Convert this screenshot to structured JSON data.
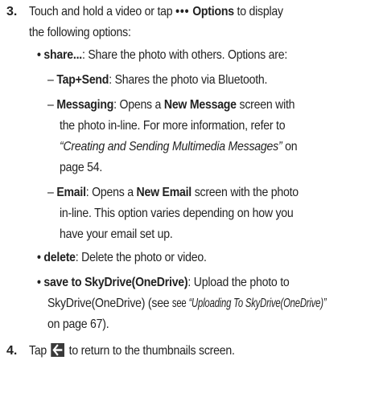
{
  "step3": {
    "number": "3.",
    "line1": "Touch and hold a video or tap",
    "options_icon": "•••",
    "options_label": "Options",
    "line1_end": "to display",
    "line2": "the following options:",
    "share": {
      "label": "share...",
      "text": ": Share the photo with others. Options are:"
    },
    "tapsend": {
      "dash": "–",
      "label": "Tap+Send",
      "text": ": Shares the photo via Bluetooth."
    },
    "messaging": {
      "dash": "–",
      "label": "Messaging",
      "text_a": ": Opens a",
      "screen_label": "New Message",
      "text_b": "screen with",
      "line2": "the photo in-line. For more information, refer to",
      "ref": "“Creating and Sending Multimedia Messages”",
      "ref_after": "on",
      "line4": "page 54."
    },
    "email": {
      "dash": "–",
      "label": "Email",
      "text_a": ": Opens a",
      "screen_label": "New Email",
      "text_b": "screen with the photo",
      "line2": "in-line. This option varies depending on how you",
      "line3": "have your email set up."
    },
    "delete": {
      "label": "delete",
      "text": ": Delete the photo or video."
    },
    "save": {
      "label": "save to SkyDrive(OneDrive)",
      "text": ": Upload the photo to",
      "line2_a": "SkyDrive(OneDrive) (see",
      "line2_see": "see",
      "line2_ref": "“Uploading To SkyDrive(OneDrive)”",
      "line3": "on page 67)."
    }
  },
  "step4": {
    "number": "4.",
    "text_a": "Tap",
    "icon": "back-arrow-icon",
    "text_b": "to return to the thumbnails screen."
  }
}
